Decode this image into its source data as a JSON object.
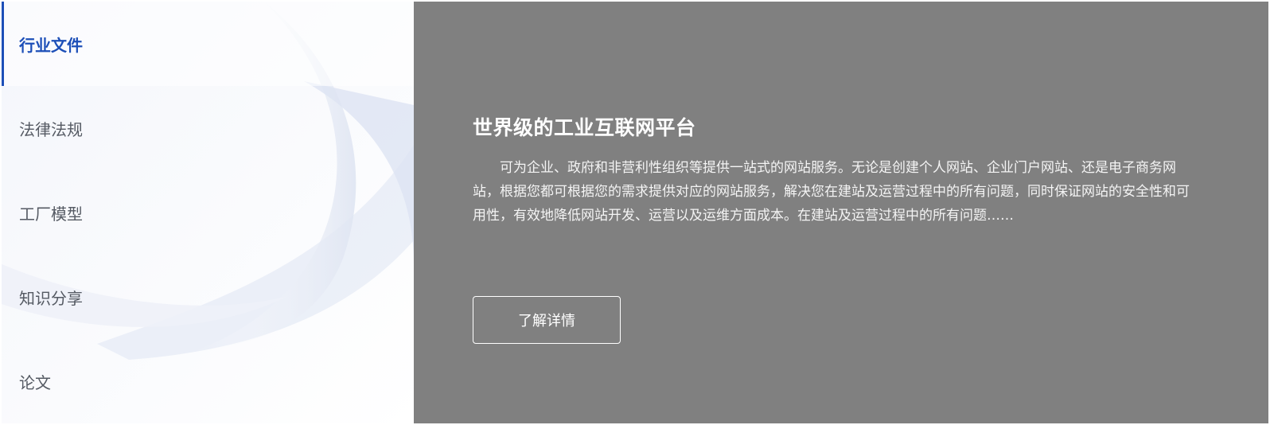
{
  "sidebar": {
    "items": [
      {
        "label": "行业文件",
        "active": true
      },
      {
        "label": "法律法规",
        "active": false
      },
      {
        "label": "工厂模型",
        "active": false
      },
      {
        "label": "知识分享",
        "active": false
      },
      {
        "label": "论文",
        "active": false
      }
    ]
  },
  "panel": {
    "title": "世界级的工业互联网平台",
    "description": "可为企业、政府和非营利性组织等提供一站式的网站服务。无论是创建个人网站、企业门户网站、还是电子商务网站，根据您都可根据您的需求提供对应的网站服务，解决您在建站及运营过程中的所有问题，同时保证网站的安全性和可用性，有效地降低网站开发、运营以及运维方面成本。在建站及运营过程中的所有问题……",
    "button_label": "了解详情"
  },
  "colors": {
    "accent": "#1d4fb8",
    "panel_bg": "#808080",
    "nav_text": "#555a63"
  }
}
